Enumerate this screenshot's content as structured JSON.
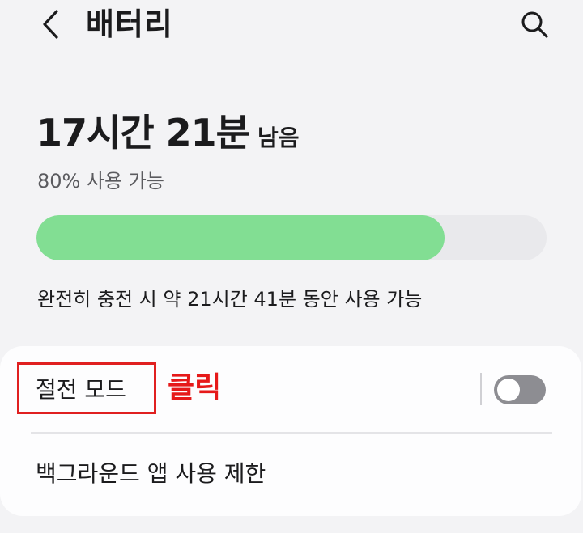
{
  "header": {
    "title": "배터리",
    "back_icon": "chevron-left-icon",
    "search_icon": "search-icon"
  },
  "battery": {
    "time_remaining": "17시간 21분",
    "remaining_suffix": "남음",
    "available_text": "80% 사용 가능",
    "level_percent": 80,
    "full_charge_text": "완전히 충전 시 약 21시간 41분 동안 사용 가능",
    "bar_color": "#82de93"
  },
  "settings": {
    "power_saving_label": "절전 모드",
    "power_saving_enabled": false,
    "click_annotation": "클릭",
    "background_limit_label": "백그라운드 앱 사용 제한"
  },
  "colors": {
    "annotation_red": "#e61919",
    "toggle_off": "#8d8d92"
  }
}
